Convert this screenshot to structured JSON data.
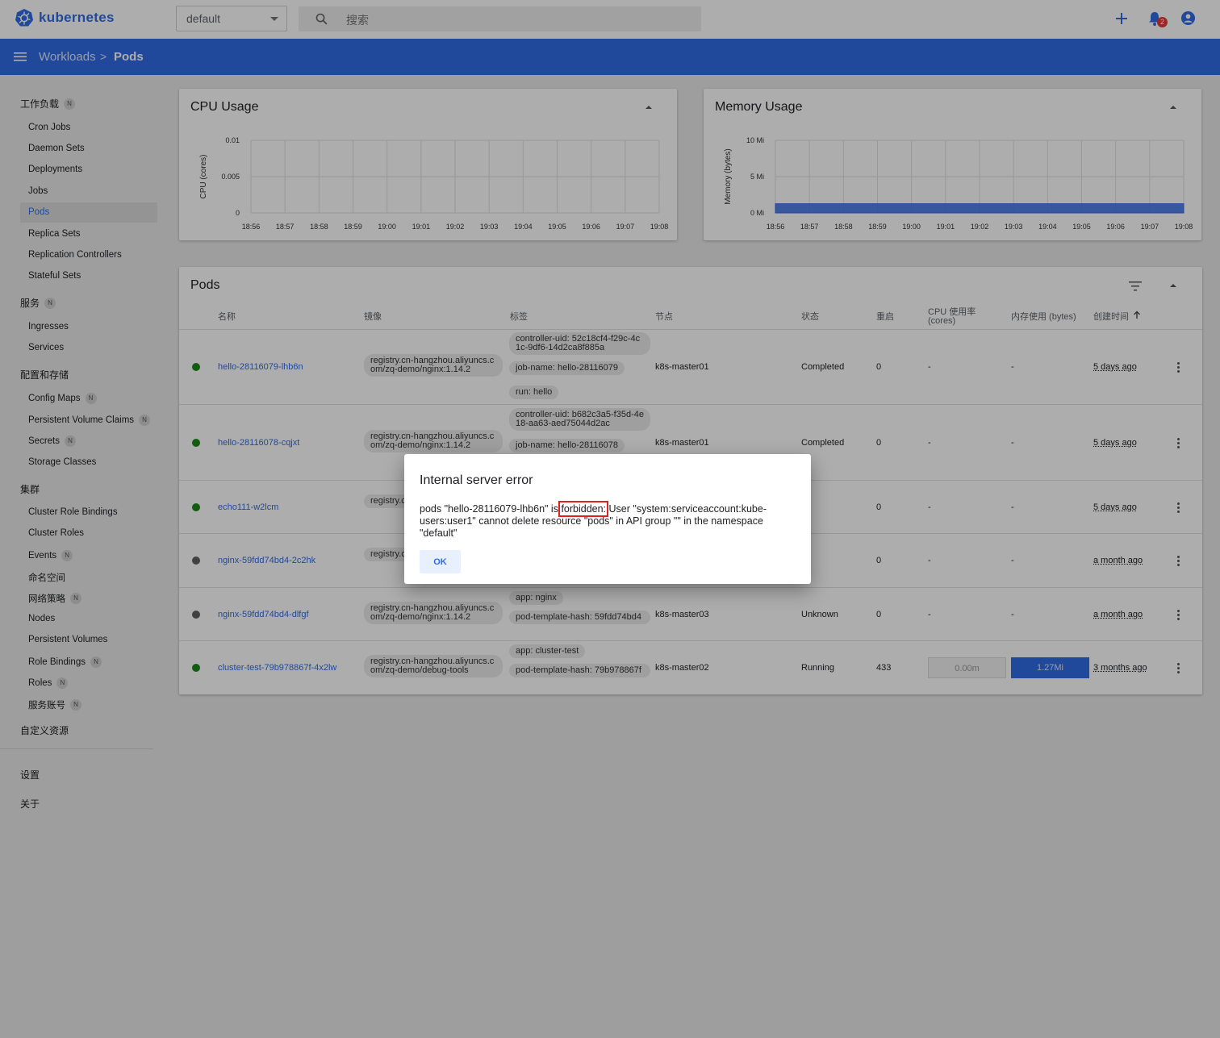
{
  "header": {
    "app_name": "kubernetes",
    "namespace": "default",
    "search_placeholder": "搜索",
    "notification_count": "2"
  },
  "breadcrumb": {
    "parent": "Workloads",
    "separator": ">",
    "current": "Pods"
  },
  "sidebar": {
    "cat_workloads": "工作负载",
    "items_workloads": [
      "Cron Jobs",
      "Daemon Sets",
      "Deployments",
      "Jobs",
      "Pods",
      "Replica Sets",
      "Replication Controllers",
      "Stateful Sets"
    ],
    "cat_services": "服务",
    "items_services": [
      "Ingresses",
      "Services"
    ],
    "cat_config": "配置和存储",
    "items_config": [
      "Config Maps",
      "Persistent Volume Claims",
      "Secrets",
      "Storage Classes"
    ],
    "cat_cluster": "集群",
    "items_cluster": [
      "Cluster Role Bindings",
      "Cluster Roles",
      "Events",
      "命名空间",
      "网络策略",
      "Nodes",
      "Persistent Volumes",
      "Role Bindings",
      "Roles",
      "服务账号"
    ],
    "crd": "自定义资源",
    "settings": "设置",
    "about": "关于",
    "badge": "N"
  },
  "cpu_card": {
    "title": "CPU Usage",
    "chart_data": {
      "type": "area",
      "title": "CPU Usage",
      "ylabel": "CPU (cores)",
      "ylim": [
        0,
        0.01
      ],
      "yticks": [
        "0.01",
        "0.005",
        "0"
      ],
      "x": [
        "18:56",
        "18:57",
        "18:58",
        "18:59",
        "19:00",
        "19:01",
        "19:02",
        "19:03",
        "19:04",
        "19:05",
        "19:06",
        "19:07",
        "19:08"
      ],
      "series": [
        {
          "values": []
        }
      ]
    }
  },
  "mem_card": {
    "title": "Memory Usage",
    "chart_data": {
      "type": "area",
      "title": "Memory Usage",
      "ylabel": "Memory (bytes)",
      "ylim": [
        0,
        10
      ],
      "yticks": [
        "10 Mi",
        "5 Mi",
        "0 Mi"
      ],
      "x": [
        "18:56",
        "18:57",
        "18:58",
        "18:59",
        "19:00",
        "19:01",
        "19:02",
        "19:03",
        "19:04",
        "19:05",
        "19:06",
        "19:07",
        "19:08"
      ],
      "series": [
        {
          "values": [
            1.27,
            1.27,
            1.27,
            1.27,
            1.27,
            1.27,
            1.27,
            1.27,
            1.27,
            1.27,
            1.27,
            1.27,
            1.27
          ]
        }
      ]
    }
  },
  "pods": {
    "title": "Pods",
    "columns": {
      "name": "名称",
      "image": "镜像",
      "labels": "标签",
      "node": "节点",
      "status": "状态",
      "restarts": "重启",
      "cpu1": "CPU 使用率",
      "cpu2": "(cores)",
      "mem": "内存使用 (bytes)",
      "created": "创建时间"
    },
    "rows": [
      {
        "name": "hello-28116079-lhb6n",
        "image": "registry.cn-hangzhou.aliyuncs.com/zq-demo/nginx:1.14.2",
        "labels": [
          "controller-uid: 52c18cf4-f29c-4c1c-9df6-14d2ca8f885a",
          "job-name: hello-28116079",
          "run: hello"
        ],
        "node": "k8s-master01",
        "status": "Completed",
        "restarts": "0",
        "cpu": "-",
        "mem": "-",
        "created": "5 days ago"
      },
      {
        "name": "hello-28116078-cqjxt",
        "image": "registry.cn-hangzhou.aliyuncs.com/zq-demo/nginx:1.14.2",
        "labels": [
          "controller-uid: b682c3a5-f35d-4e18-aa63-aed75044d2ac",
          "job-name: hello-28116078"
        ],
        "node": "k8s-master01",
        "status": "Completed",
        "restarts": "0",
        "cpu": "-",
        "mem": "-",
        "created": "5 days ago"
      },
      {
        "name": "echo111-w2lcm",
        "image": "registry.c om/zq-d",
        "labels": [],
        "node": "",
        "status": "mpleted",
        "restarts": "0",
        "cpu": "-",
        "mem": "-",
        "created": "5 days ago"
      },
      {
        "name": "nginx-59fdd74bd4-2c2hk",
        "image": "registry.c om/zq-d",
        "labels": [],
        "node": "",
        "status": "known",
        "restarts": "0",
        "cpu": "-",
        "mem": "-",
        "created": "a month ago"
      },
      {
        "name": "nginx-59fdd74bd4-dlfgf",
        "image": "registry.cn-hangzhou.aliyuncs.com/zq-demo/nginx:1.14.2",
        "labels": [
          "app: nginx",
          "pod-template-hash: 59fdd74bd4"
        ],
        "node": "k8s-master03",
        "status": "Unknown",
        "restarts": "0",
        "cpu": "-",
        "mem": "-",
        "created": "a month ago"
      },
      {
        "name": "cluster-test-79b978867f-4x2lw",
        "image": "registry.cn-hangzhou.aliyuncs.com/zq-demo/debug-tools",
        "labels": [
          "app: cluster-test",
          "pod-template-hash: 79b978867f"
        ],
        "node": "k8s-master02",
        "status": "Running",
        "restarts": "433",
        "cpu": "0.00m",
        "mem": "1.27Mi",
        "created": "3 months ago"
      }
    ]
  },
  "dialog": {
    "title": "Internal server error",
    "msg_before": "pods \"hello-28116079-lhb6n\" is ",
    "msg_highlight": "forbidden:",
    "msg_after": " User \"system:serviceaccount:kube-users:user1\" cannot delete resource \"pods\" in API group \"\" in the namespace \"default\"",
    "ok": "OK"
  },
  "colors": {
    "accent": "#326ce5",
    "status_ok": "#1b8a1b",
    "status_unknown": "#616161",
    "highlight": "#e02020"
  }
}
